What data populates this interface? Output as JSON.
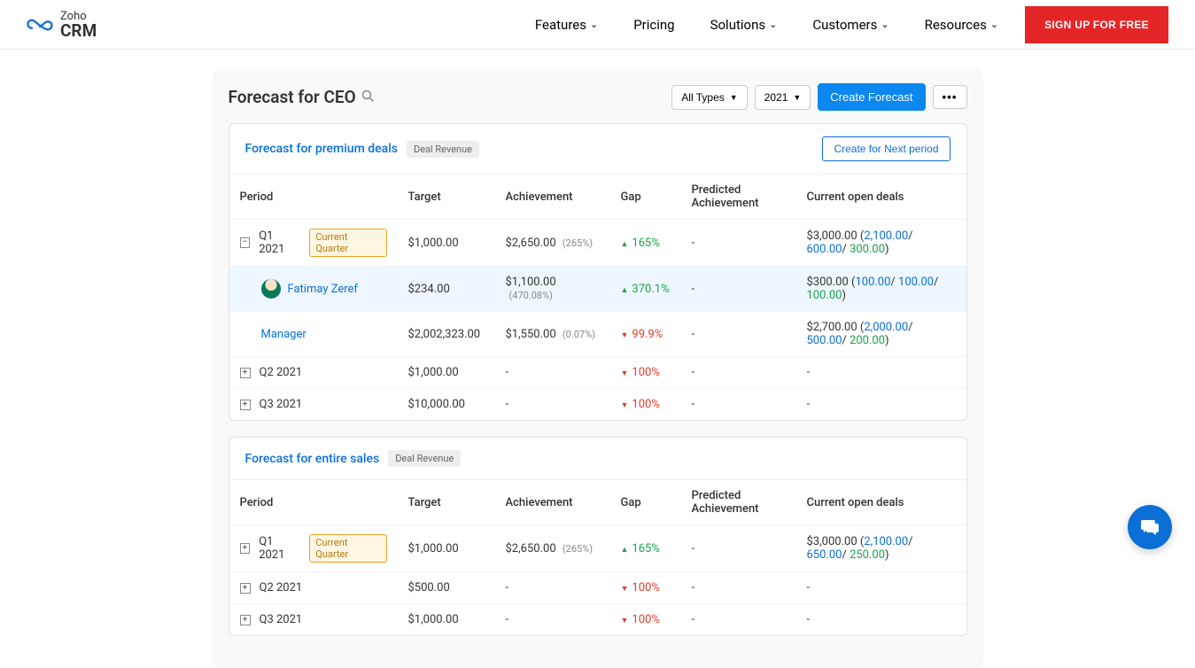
{
  "nav": {
    "brand_top": "Zoho",
    "brand_bottom": "CRM",
    "links": {
      "features": "Features",
      "pricing": "Pricing",
      "solutions": "Solutions",
      "customers": "Customers",
      "resources": "Resources"
    },
    "signup": "SIGN UP FOR FREE"
  },
  "header": {
    "title": "Forecast for CEO",
    "type_filter": "All Types",
    "year_filter": "2021",
    "create_btn": "Create Forecast"
  },
  "columns": {
    "period": "Period",
    "target": "Target",
    "achievement": "Achievement",
    "gap": "Gap",
    "predicted": "Predicted Achievement",
    "open_deals": "Current open deals"
  },
  "premium": {
    "title": "Forecast for premium deals",
    "chip": "Deal Revenue",
    "next_btn": "Create for Next period",
    "rows": {
      "q1": {
        "period": "Q1 2021",
        "badge": "Current Quarter",
        "target": "$1,000.00",
        "achievement": "$2,650.00",
        "achievement_pct": "(265%)",
        "gap": "165%",
        "predicted": "-",
        "deals_total": "$3,000.00",
        "deals_p1": "2,100.00",
        "deals_p2": "600.00",
        "deals_p3": "300.00"
      },
      "user1": {
        "name": "Fatimay Zeref",
        "target": "$234.00",
        "achievement": "$1,100.00",
        "achievement_pct": "(470.08%)",
        "gap": "370.1%",
        "predicted": "-",
        "deals_total": "$300.00",
        "deals_p1": "100.00",
        "deals_p2": "100.00",
        "deals_p3": "100.00"
      },
      "manager": {
        "name": "Manager",
        "target": "$2,002,323.00",
        "achievement": "$1,550.00",
        "achievement_pct": "(0.07%)",
        "gap": "99.9%",
        "predicted": "-",
        "deals_total": "$2,700.00",
        "deals_p1": "2,000.00",
        "deals_p2": "500.00",
        "deals_p3": "200.00"
      },
      "q2": {
        "period": "Q2 2021",
        "target": "$1,000.00",
        "achievement": "-",
        "gap": "100%",
        "predicted": "-",
        "deals": "-"
      },
      "q3": {
        "period": "Q3 2021",
        "target": "$10,000.00",
        "achievement": "-",
        "gap": "100%",
        "predicted": "-",
        "deals": "-"
      }
    }
  },
  "entire": {
    "title": "Forecast for entire sales",
    "chip": "Deal Revenue",
    "rows": {
      "q1": {
        "period": "Q1 2021",
        "badge": "Current Quarter",
        "target": "$1,000.00",
        "achievement": "$2,650.00",
        "achievement_pct": "(265%)",
        "gap": "165%",
        "predicted": "-",
        "deals_total": "$3,000.00",
        "deals_p1": "2,100.00",
        "deals_p2": "650.00",
        "deals_p3": "250.00"
      },
      "q2": {
        "period": "Q2 2021",
        "target": "$500.00",
        "achievement": "-",
        "gap": "100%",
        "predicted": "-",
        "deals": "-"
      },
      "q3": {
        "period": "Q3 2021",
        "target": "$1,000.00",
        "achievement": "-",
        "gap": "100%",
        "predicted": "-",
        "deals": "-"
      }
    }
  }
}
